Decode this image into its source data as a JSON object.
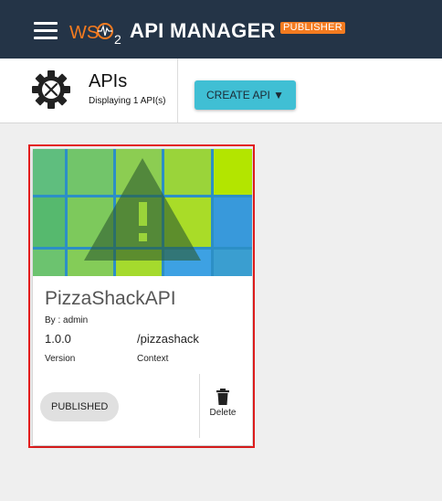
{
  "header": {
    "logo_text": "WSO2",
    "product_name": "API MANAGER",
    "badge": "PUBLISHER",
    "menu_icon": "hamburger-menu-icon"
  },
  "page": {
    "icon": "gear-tools-icon",
    "title": "APIs",
    "subtitle": "Displaying 1 API(s)",
    "create_label": "CREATE API ▼"
  },
  "api_card": {
    "name": "PizzaShackAPI",
    "by": "By : admin",
    "version": "1.0.0",
    "version_label": "Version",
    "context": "/pizzashack",
    "context_label": "Context",
    "status": "PUBLISHED",
    "delete_label": "Delete",
    "thumbnail_icon": "warning-icon"
  },
  "colors": {
    "appbar": "#243447",
    "accent_orange": "#f47b20",
    "button": "#40bfd4",
    "highlight_border": "#e31d1d"
  }
}
